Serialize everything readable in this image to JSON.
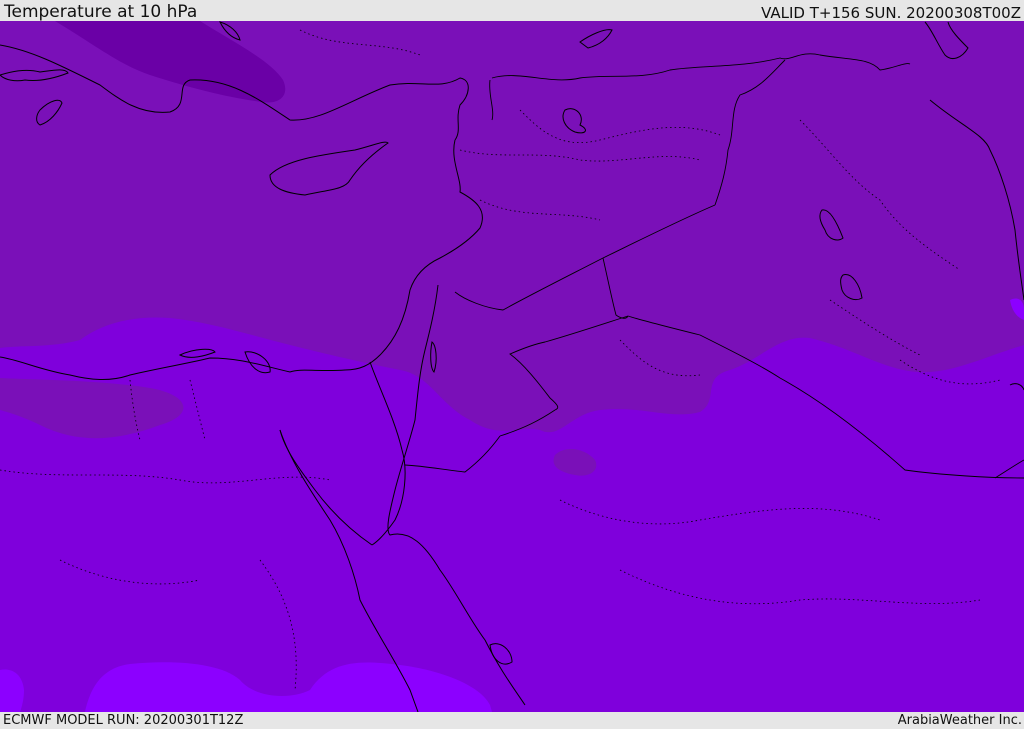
{
  "header": {
    "title": "Temperature at 10 hPa",
    "valid_time": "VALID T+156 SUN. 20200308T00Z"
  },
  "footer": {
    "model_run": "ECMWF MODEL RUN: 20200301T12Z",
    "credit": "ArabiaWeather Inc."
  },
  "map": {
    "field": "Temperature at 10 hPa",
    "fill_colors": {
      "darkest": "#6a00a6",
      "dark": "#7a10b8",
      "mid": "#7f00dc",
      "light": "#8c00ff"
    },
    "coastline_color": "#000000",
    "border_style": "dotted"
  }
}
